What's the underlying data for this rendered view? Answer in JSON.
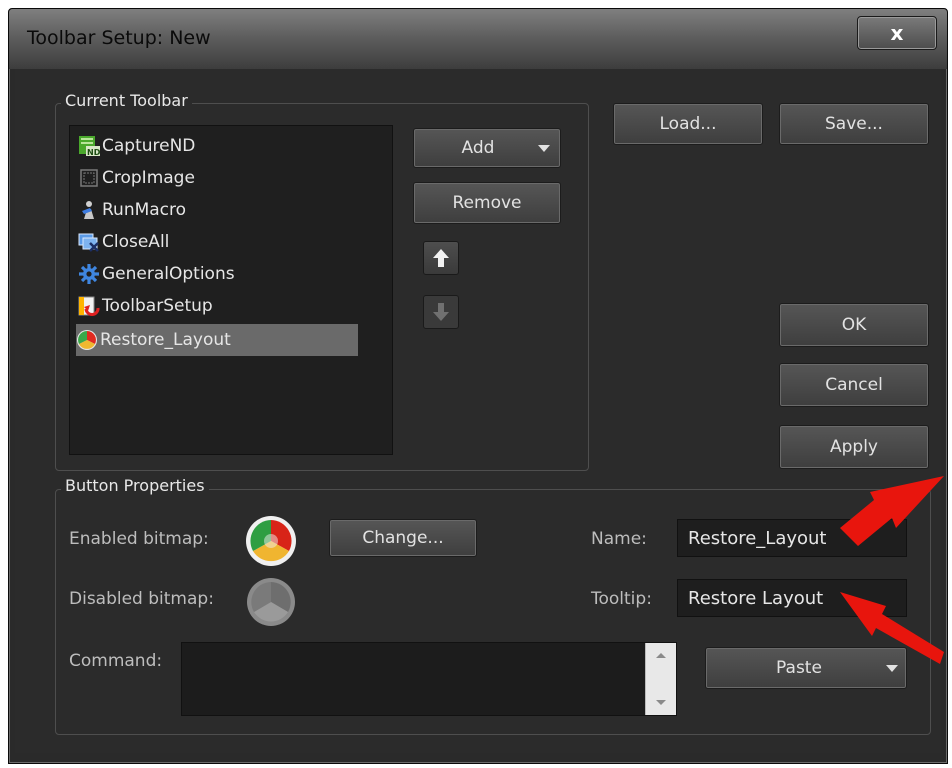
{
  "window": {
    "title": "Toolbar Setup: New",
    "close_label": "x"
  },
  "current_toolbar": {
    "group_label": "Current Toolbar",
    "items": [
      {
        "label": "CaptureND",
        "icon": "capture-nd-icon",
        "selected": false
      },
      {
        "label": "CropImage",
        "icon": "crop-image-icon",
        "selected": false
      },
      {
        "label": "RunMacro",
        "icon": "run-macro-icon",
        "selected": false
      },
      {
        "label": "CloseAll",
        "icon": "close-all-icon",
        "selected": false
      },
      {
        "label": "GeneralOptions",
        "icon": "gear-icon",
        "selected": false
      },
      {
        "label": "ToolbarSetup",
        "icon": "toolbar-setup-icon",
        "selected": false
      },
      {
        "label": "Restore_Layout",
        "icon": "restore-layout-icon",
        "selected": true
      }
    ],
    "add_label": "Add",
    "remove_label": "Remove"
  },
  "actions": {
    "load_label": "Load...",
    "save_label": "Save...",
    "ok_label": "OK",
    "cancel_label": "Cancel",
    "apply_label": "Apply"
  },
  "button_properties": {
    "group_label": "Button Properties",
    "enabled_bitmap_label": "Enabled bitmap:",
    "disabled_bitmap_label": "Disabled bitmap:",
    "change_label": "Change...",
    "name_label": "Name:",
    "name_value": "Restore_Layout",
    "tooltip_label": "Tooltip:",
    "tooltip_value": "Restore Layout",
    "command_label": "Command:",
    "command_value": "",
    "paste_label": "Paste"
  },
  "colors": {
    "annotation_arrow": "#e8150d",
    "dialog_bg": "#2b2b2b",
    "selection": "#6a6a6a"
  }
}
